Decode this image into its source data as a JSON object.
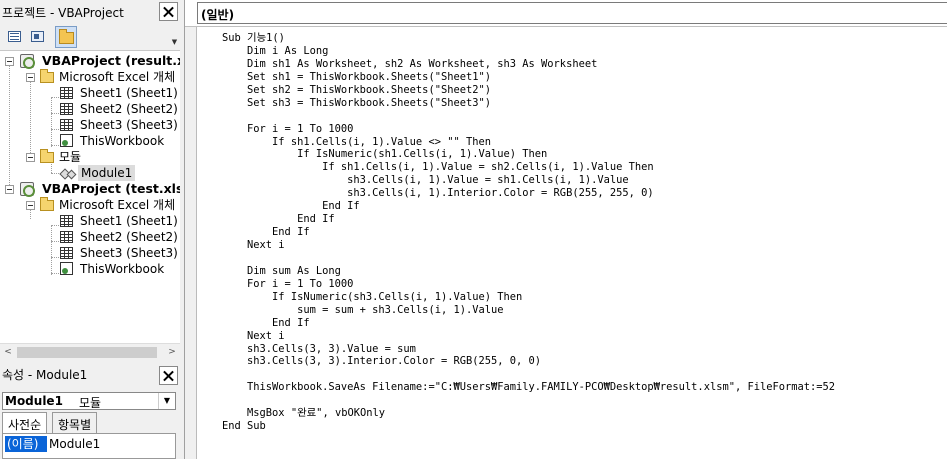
{
  "project_explorer": {
    "title": "프로젝트 - VBAProject",
    "tree": [
      {
        "label": "VBAProject (result.xl",
        "icon": "project-icon",
        "bold": true
      },
      {
        "label": "Microsoft Excel 개체",
        "icon": "folder-icon"
      },
      {
        "label": "Sheet1 (Sheet1)",
        "icon": "sheet-icon"
      },
      {
        "label": "Sheet2 (Sheet2)",
        "icon": "sheet-icon"
      },
      {
        "label": "Sheet3 (Sheet3)",
        "icon": "sheet-icon"
      },
      {
        "label": "ThisWorkbook",
        "icon": "workbook-icon"
      },
      {
        "label": "모듈",
        "icon": "folder-icon"
      },
      {
        "label": "Module1",
        "icon": "module-icon",
        "selected": true
      },
      {
        "label": "VBAProject (test.xlsı",
        "icon": "project-icon",
        "bold": true
      },
      {
        "label": "Microsoft Excel 개체",
        "icon": "folder-icon"
      },
      {
        "label": "Sheet1 (Sheet1)",
        "icon": "sheet-icon"
      },
      {
        "label": "Sheet2 (Sheet2)",
        "icon": "sheet-icon"
      },
      {
        "label": "Sheet3 (Sheet3)",
        "icon": "sheet-icon"
      },
      {
        "label": "ThisWorkbook",
        "icon": "workbook-icon"
      }
    ]
  },
  "properties": {
    "title": "속성 - Module1",
    "object_name": "Module1",
    "object_type": "모듈",
    "tabs": [
      "사전순",
      "항목별"
    ],
    "rows": [
      {
        "name": "(이름)",
        "value": "Module1"
      }
    ]
  },
  "code_window": {
    "object_dropdown": "(일반)",
    "lines": [
      "Sub 기능1()",
      "    Dim i As Long",
      "    Dim sh1 As Worksheet, sh2 As Worksheet, sh3 As Worksheet",
      "    Set sh1 = ThisWorkbook.Sheets(\"Sheet1\")",
      "    Set sh2 = ThisWorkbook.Sheets(\"Sheet2\")",
      "    Set sh3 = ThisWorkbook.Sheets(\"Sheet3\")",
      "",
      "    For i = 1 To 1000",
      "        If sh1.Cells(i, 1).Value <> \"\" Then",
      "            If IsNumeric(sh1.Cells(i, 1).Value) Then",
      "                If sh1.Cells(i, 1).Value = sh2.Cells(i, 1).Value Then",
      "                    sh3.Cells(i, 1).Value = sh1.Cells(i, 1).Value",
      "                    sh3.Cells(i, 1).Interior.Color = RGB(255, 255, 0)",
      "                End If",
      "            End If",
      "        End If",
      "    Next i",
      "",
      "    Dim sum As Long",
      "    For i = 1 To 1000",
      "        If IsNumeric(sh3.Cells(i, 1).Value) Then",
      "            sum = sum + sh3.Cells(i, 1).Value",
      "        End If",
      "    Next i",
      "    sh3.Cells(3, 3).Value = sum",
      "    sh3.Cells(3, 3).Interior.Color = RGB(255, 0, 0)",
      "",
      "    ThisWorkbook.SaveAs Filename:=\"C:₩Users₩Family.FAMILY-PCO₩Desktop₩result.xlsm\", FileFormat:=52",
      "",
      "    MsgBox \"완료\", vbOKOnly",
      "End Sub"
    ]
  }
}
